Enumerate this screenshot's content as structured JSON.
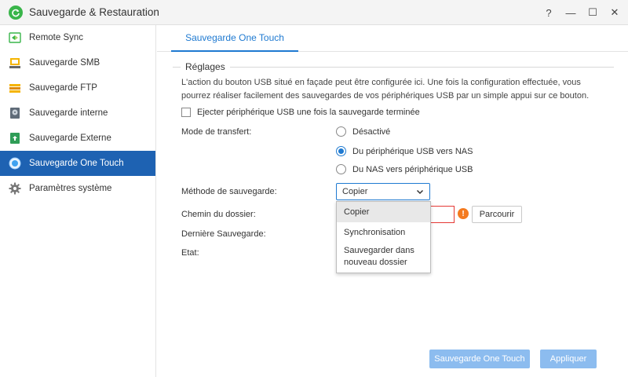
{
  "window": {
    "title": "Sauvegarde & Restauration",
    "controls": [
      "?",
      "—",
      "☐",
      "✕"
    ]
  },
  "sidebar": {
    "items": [
      {
        "label": "Remote Sync",
        "icon": "remote-sync-icon"
      },
      {
        "label": "Sauvegarde SMB",
        "icon": "smb-backup-icon"
      },
      {
        "label": "Sauvegarde FTP",
        "icon": "ftp-backup-icon"
      },
      {
        "label": "Sauvegarde interne",
        "icon": "internal-backup-icon"
      },
      {
        "label": "Sauvegarde Externe",
        "icon": "external-backup-icon"
      },
      {
        "label": "Sauvegarde One Touch",
        "icon": "one-touch-icon",
        "active": true
      },
      {
        "label": "Paramètres système",
        "icon": "gear-icon"
      }
    ]
  },
  "tab": {
    "label": "Sauvegarde One Touch"
  },
  "settings": {
    "section_title": "Réglages",
    "description": "L'action du bouton USB situé en façade peut être configurée ici. Une fois la configuration effectuée, vous pourrez réaliser facilement des sauvegardes de vos périphériques USB par un simple appui sur ce bouton.",
    "eject_label": "Ejecter périphérique USB une fois la sauvegarde terminée",
    "eject_checked": false,
    "transfer_mode_label": "Mode de transfert:",
    "transfer_modes": [
      {
        "label": "Désactivé",
        "checked": false
      },
      {
        "label": "Du périphérique USB vers NAS",
        "checked": true
      },
      {
        "label": "Du NAS vers périphérique USB",
        "checked": false
      }
    ],
    "backup_method_label": "Méthode de sauvegarde:",
    "backup_method_value": "Copier",
    "backup_method_options": [
      "Copier",
      "Synchronisation",
      "Sauvegarder dans nouveau dossier"
    ],
    "folder_path_label": "Chemin du dossier:",
    "folder_path_value": "",
    "browse_label": "Parcourir",
    "last_backup_label": "Dernière Sauvegarde:",
    "status_label": "Etat:"
  },
  "footer": {
    "one_touch_button": "Sauvegarde One Touch",
    "apply_button": "Appliquer"
  },
  "colors": {
    "accent": "#1f7ad1",
    "active_sidebar": "#1e62b2",
    "error": "#e53935",
    "warning": "#f47a1f",
    "disabled_button": "#8cbcef"
  }
}
